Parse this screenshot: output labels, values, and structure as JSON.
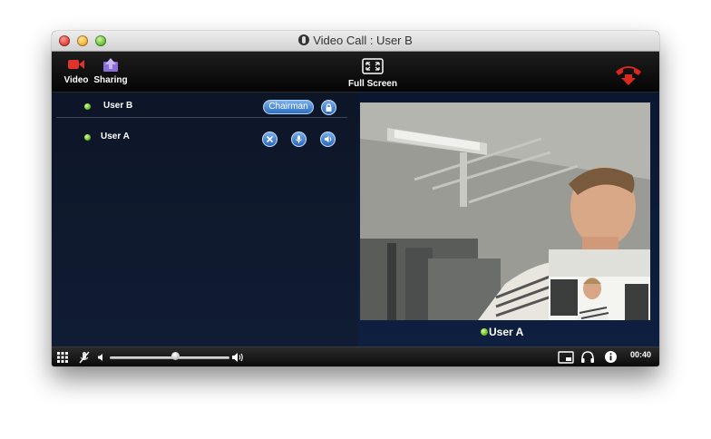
{
  "window": {
    "title": "Video Call : User B"
  },
  "toolbar": {
    "video_label": "Video",
    "sharing_label": "Sharing",
    "fullscreen_label": "Full Screen"
  },
  "participants": [
    {
      "name": "User B",
      "status": "online",
      "role_badge": "Chairman",
      "icons": [
        "lock-icon"
      ]
    },
    {
      "name": "User A",
      "status": "online",
      "icons": [
        "close-icon",
        "microphone-icon",
        "speaker-icon"
      ]
    }
  ],
  "video": {
    "caption": "User A"
  },
  "bottombar": {
    "volume_level": 0.55,
    "timer": "00:40",
    "icons": [
      "grid-icon",
      "mic-mute-icon",
      "volume-low-icon",
      "volume-high-icon",
      "screen-icon",
      "headset-icon",
      "info-icon"
    ]
  },
  "colors": {
    "accent_blue": "#2d6fc3",
    "status_green": "#57b31b",
    "panel_bg": "#0d1627",
    "hangup_red": "#d9281c"
  }
}
